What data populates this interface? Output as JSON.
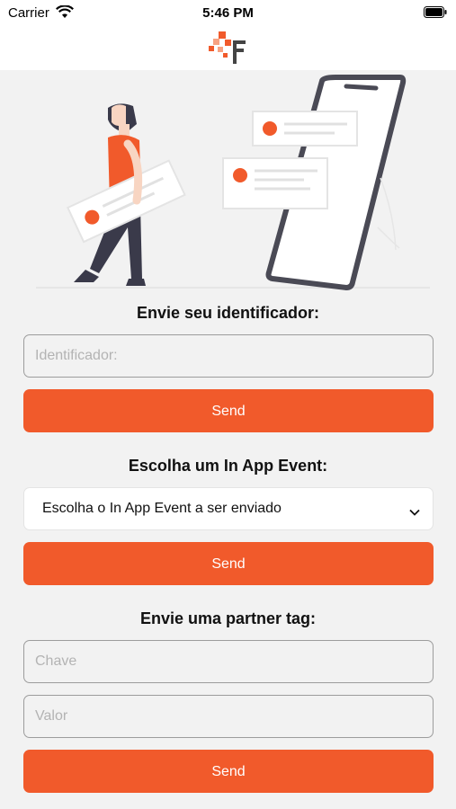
{
  "status_bar": {
    "carrier": "Carrier",
    "time": "5:46 PM"
  },
  "colors": {
    "accent": "#f15a2b",
    "background": "#f2f2f2"
  },
  "icons": {
    "wifi": "wifi-icon",
    "battery": "battery-icon",
    "logo": "brand-logo-icon",
    "chevron": "chevron-down-icon"
  },
  "identifier_section": {
    "title": "Envie seu identificador:",
    "input_placeholder": "Identificador:",
    "input_value": "",
    "button_label": "Send"
  },
  "event_section": {
    "title": "Escolha um In App Event:",
    "select_value": "Escolha o In App Event a ser enviado",
    "button_label": "Send"
  },
  "partner_tag_section": {
    "title": "Envie uma partner tag:",
    "key_placeholder": "Chave",
    "value_placeholder": "Valor",
    "button_label": "Send"
  }
}
